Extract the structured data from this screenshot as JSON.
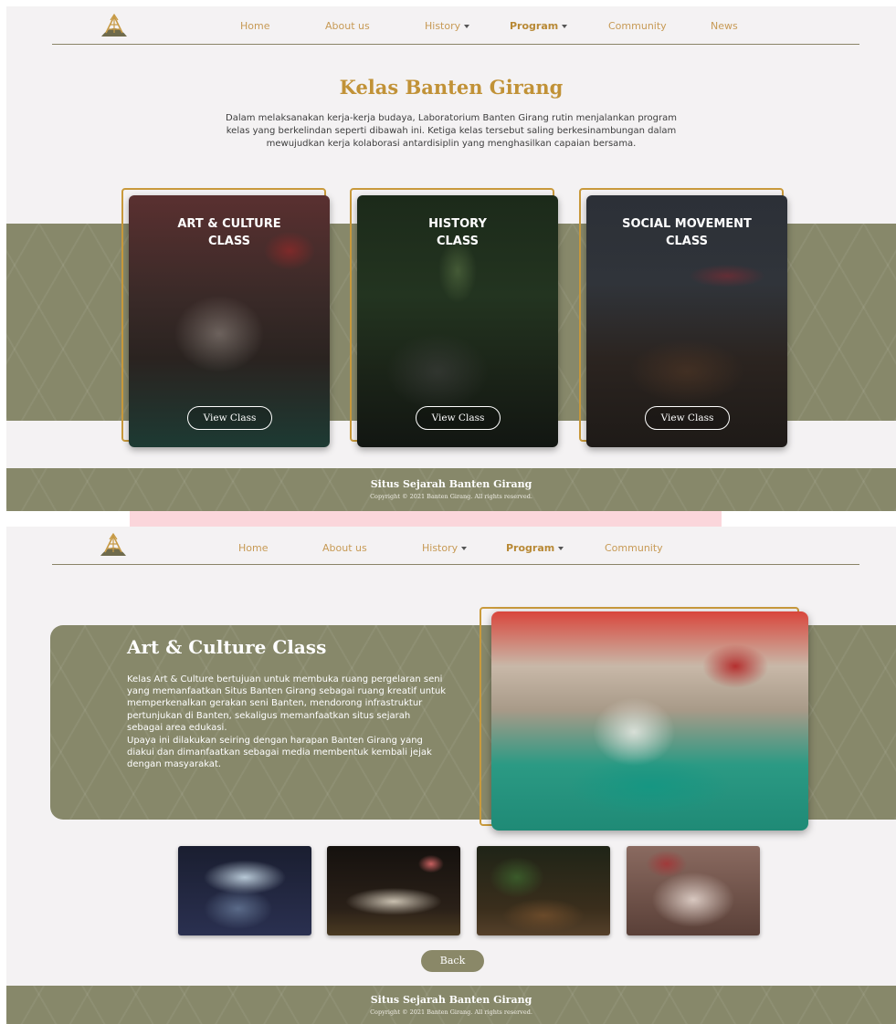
{
  "nav": {
    "items": [
      {
        "label": "Home"
      },
      {
        "label": "About us"
      },
      {
        "label": "History"
      },
      {
        "label": "Program"
      },
      {
        "label": "Community"
      },
      {
        "label": "News"
      }
    ]
  },
  "program_page": {
    "title": "Kelas Banten Girang",
    "intro": "Dalam melaksanakan kerja-kerja budaya, Laboratorium Banten Girang rutin menjalankan program kelas yang berkelindan seperti dibawah ini. Ketiga kelas tersebut saling berkesinambungan dalam mewujudkan kerja kolaborasi antardisiplin yang menghasilkan capaian bersama.",
    "cards": [
      {
        "title_line1": "ART & CULTURE",
        "title_line2": "CLASS",
        "button": "View Class"
      },
      {
        "title_line1": "HISTORY",
        "title_line2": "CLASS",
        "button": "View Class"
      },
      {
        "title_line1": "SOCIAL MOVEMENT",
        "title_line2": "CLASS",
        "button": "View Class"
      }
    ]
  },
  "footer": {
    "title": "Situs Sejarah Banten Girang",
    "copyright": "Copyright © 2021 Banten Girang. All rights reserved."
  },
  "detail_page": {
    "title": "Art & Culture Class",
    "paragraph1": "Kelas Art & Culture bertujuan untuk membuka ruang pergelaran seni yang memanfaatkan Situs Banten Girang sebagai ruang kreatif untuk memperkenalkan gerakan seni Banten, mendorong infrastruktur pertunjukan di Banten, sekaligus memanfaatkan situs sejarah sebagai area edukasi.",
    "paragraph2": "Upaya ini dilakukan seiring dengan harapan Banten Girang yang diakui dan dimanfaatkan sebagai media membentuk kembali jejak dengan masyarakat.",
    "back_button": "Back"
  },
  "colors": {
    "accent_gold": "#c19237",
    "olive": "#87886a",
    "background": "#f4f2f3"
  }
}
